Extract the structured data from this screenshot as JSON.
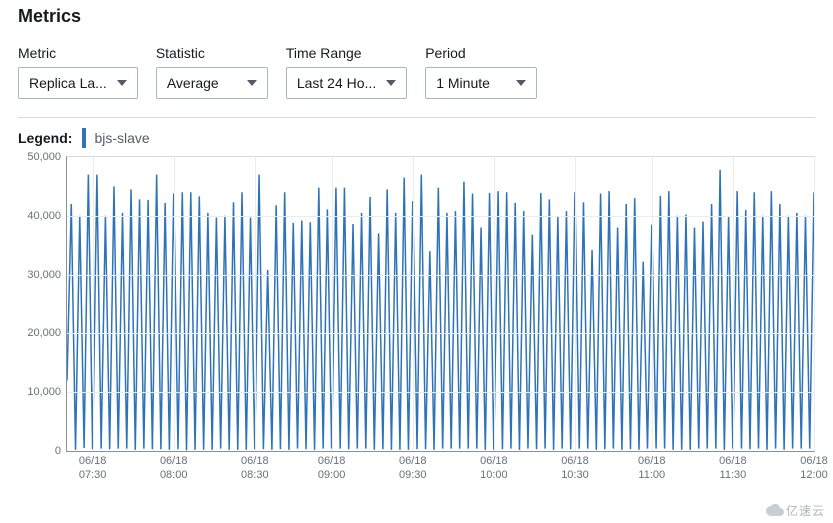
{
  "page_title": "Metrics",
  "controls": {
    "metric": {
      "label": "Metric",
      "value": "Replica La..."
    },
    "statistic": {
      "label": "Statistic",
      "value": "Average"
    },
    "timerange": {
      "label": "Time Range",
      "value": "Last 24 Ho..."
    },
    "period": {
      "label": "Period",
      "value": "1 Minute"
    }
  },
  "legend": {
    "label": "Legend:",
    "series_name": "bjs-slave",
    "series_color": "#2e73b8"
  },
  "chart_data": {
    "type": "line",
    "title": "",
    "xlabel": "",
    "ylabel": "",
    "ylim": [
      0,
      50000
    ],
    "y_ticks": [
      0,
      10000,
      20000,
      30000,
      40000,
      50000
    ],
    "y_tick_labels": [
      "0",
      "10,000",
      "20,000",
      "30,000",
      "40,000",
      "50,000"
    ],
    "x_tick_labels": [
      "06/18\n07:30",
      "06/18\n08:00",
      "06/18\n08:30",
      "06/18\n09:00",
      "06/18\n09:30",
      "06/18\n10:00",
      "06/18\n10:30",
      "06/18\n11:00",
      "06/18\n11:30",
      "06/18\n12:00"
    ],
    "x_tick_indices": [
      6,
      25,
      44,
      62,
      81,
      100,
      119,
      137,
      156,
      175
    ],
    "n_points": 176,
    "series": [
      {
        "name": "bjs-slave",
        "color": "#2e73b8",
        "values": [
          12000,
          42000,
          200,
          40000,
          500,
          47000,
          300,
          47000,
          400,
          40000,
          300,
          45000,
          400,
          40500,
          400,
          44500,
          200,
          42800,
          400,
          42700,
          300,
          47000,
          300,
          42200,
          200,
          43800,
          300,
          44000,
          100,
          44000,
          200,
          43300,
          200,
          40500,
          200,
          39700,
          400,
          40000,
          200,
          42300,
          200,
          44000,
          200,
          39700,
          300,
          47000,
          300,
          30800,
          200,
          41800,
          300,
          44000,
          200,
          38800,
          400,
          39200,
          300,
          38900,
          200,
          44800,
          400,
          41100,
          400,
          44800,
          400,
          44800,
          300,
          38600,
          400,
          40500,
          400,
          43200,
          200,
          37000,
          300,
          44500,
          200,
          40500,
          200,
          46500,
          200,
          42500,
          300,
          47000,
          300,
          34000,
          200,
          44800,
          400,
          40500,
          400,
          40800,
          400,
          45800,
          400,
          43800,
          400,
          38000,
          200,
          43900,
          200,
          44200,
          300,
          44000,
          400,
          42200,
          200,
          40800,
          400,
          36800,
          300,
          43900,
          400,
          42800,
          200,
          39900,
          400,
          40800,
          300,
          44000,
          400,
          42300,
          400,
          34200,
          200,
          43800,
          300,
          44200,
          400,
          38000,
          200,
          42000,
          300,
          43000,
          200,
          32200,
          400,
          38500,
          400,
          43400,
          400,
          44200,
          200,
          40000,
          200,
          40200,
          200,
          38000,
          400,
          39000,
          400,
          42000,
          400,
          47800,
          200,
          39900,
          400,
          44200,
          400,
          41000,
          300,
          44000,
          400,
          40000,
          200,
          44200,
          400,
          42000,
          200,
          40000,
          400,
          40500,
          400,
          40000,
          400,
          44000
        ]
      }
    ]
  },
  "watermark": "亿速云"
}
